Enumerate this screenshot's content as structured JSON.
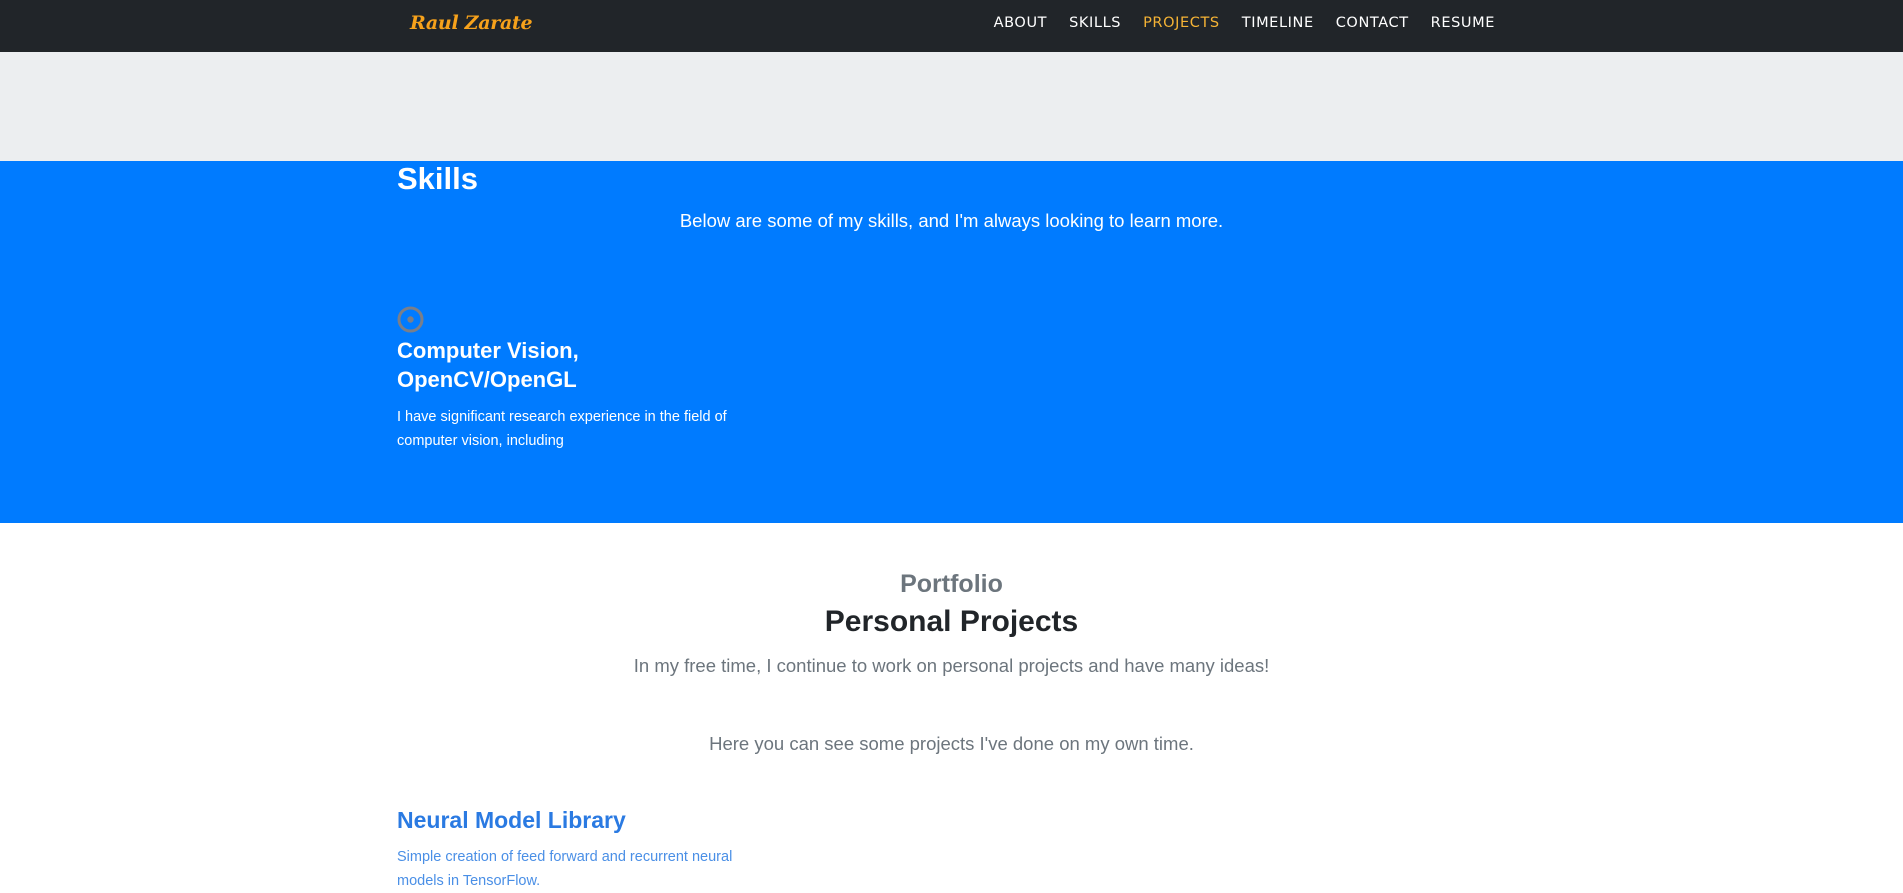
{
  "nav": {
    "brand": "Raul Zarate",
    "links": [
      {
        "label": "About"
      },
      {
        "label": "Skills"
      },
      {
        "label": "Projects"
      },
      {
        "label": "Timeline"
      },
      {
        "label": "Contact"
      },
      {
        "label": "Resume"
      }
    ],
    "active": "Projects"
  },
  "skills": {
    "title": "Skills",
    "subtitle": "Below are some of my skills, and I'm always looking to learn more.",
    "items": [
      {
        "icon": "bullseye-icon",
        "title": "Computer Vision, OpenCV/OpenGL",
        "text": "I have significant research experience in the field of computer vision, including"
      }
    ]
  },
  "portfolio": {
    "eyebrow": "Portfolio",
    "title": "Personal Projects",
    "subtitle": "In my free time, I continue to work on personal projects and have many ideas!",
    "note": "Here you can see some projects I've done on my own time.",
    "projects": [
      {
        "title": "Neural Model Library",
        "description": "Simple creation of feed forward and recurrent neural models in TensorFlow."
      }
    ]
  },
  "colors": {
    "navbar_bg": "#212529",
    "brand": "#f7a21b",
    "active_link": "#f5b335",
    "gray_band": "#eceef0",
    "skills_bg": "#007bff",
    "project_link": "#2a7ae2"
  }
}
